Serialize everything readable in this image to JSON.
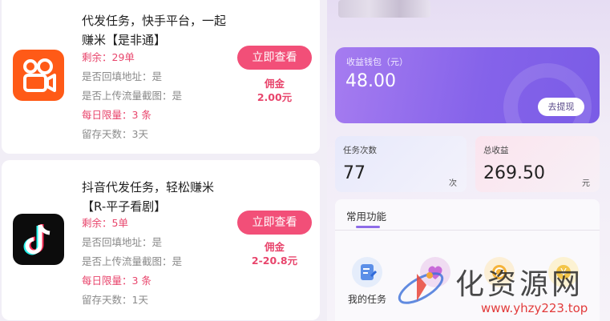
{
  "tasks": [
    {
      "title": "代发任务，快手平台，一起赚米【是非通】",
      "remaining": "剩余：29单",
      "fill_address": "是否回填地址：是",
      "upload_screenshot": "是否上传流量截图：是",
      "daily_limit": "每日限量：3 条",
      "retain_days": "留存天数：3天",
      "button": "立即查看",
      "commission_label": "佣金",
      "commission_value": "2.00元",
      "icon": "kuaishou-icon"
    },
    {
      "title": "抖音代发任务，轻松赚米【R-平子看剧】",
      "remaining": "剩余：5单",
      "fill_address": "是否回填地址：是",
      "upload_screenshot": "是否上传流量截图：是",
      "daily_limit": "每日限量：3 条",
      "retain_days": "留存天数：1天",
      "button": "立即查看",
      "commission_label": "佣金",
      "commission_value": "2-20.8元",
      "icon": "douyin-icon"
    }
  ],
  "wallet": {
    "label": "收益钱包（元）",
    "amount": "48.00",
    "withdraw": "去提现"
  },
  "stats": {
    "task_count_label": "任务次数",
    "task_count_value": "77",
    "task_count_unit": "次",
    "total_income_label": "总收益",
    "total_income_value": "269.50",
    "total_income_unit": "元"
  },
  "functions": {
    "title": "常用功能",
    "items": [
      {
        "label": "我的任务",
        "icon": "edit-icon"
      },
      {
        "label": "",
        "icon": "heart-icon"
      },
      {
        "label": "",
        "icon": "coin-icon"
      },
      {
        "label": "",
        "icon": "yen-icon"
      }
    ]
  },
  "watermark": {
    "text": "化资源网",
    "url": "www.yhzy223.top"
  },
  "colors": {
    "accent_pink": "#f24f78",
    "accent_purple": "#8563ea",
    "kuaishou_orange": "#ff5a17"
  }
}
